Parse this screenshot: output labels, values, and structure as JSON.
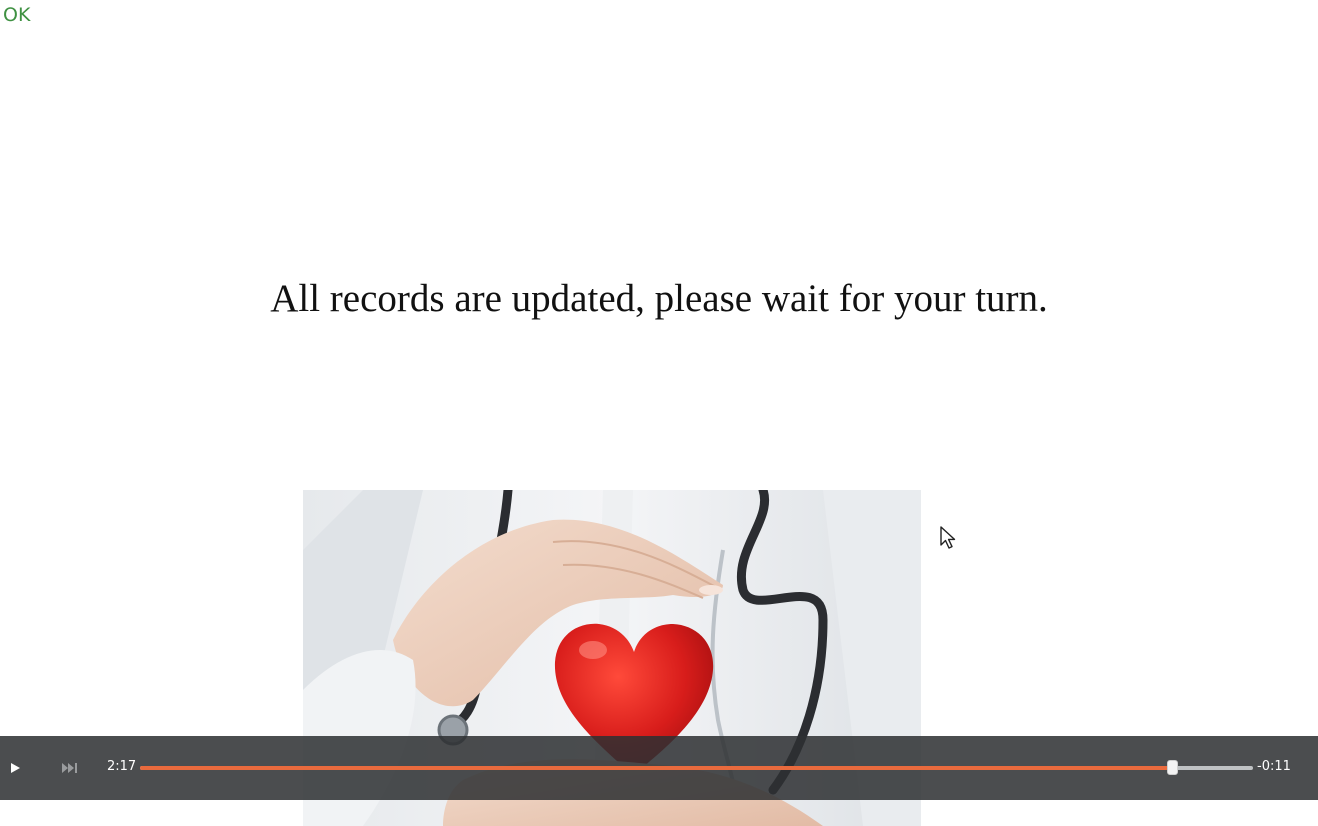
{
  "status": {
    "text": "OK",
    "color": "#3f9142"
  },
  "message": "All records are updated, please wait for your turn.",
  "image": {
    "subject": "doctor-hands-protecting-red-heart"
  },
  "player": {
    "play_icon": "play-icon",
    "skip_icon": "skip-forward-icon",
    "elapsed": "2:17",
    "remaining": "-0:11",
    "progress": 0.927,
    "accent_color": "#e96a3d"
  }
}
